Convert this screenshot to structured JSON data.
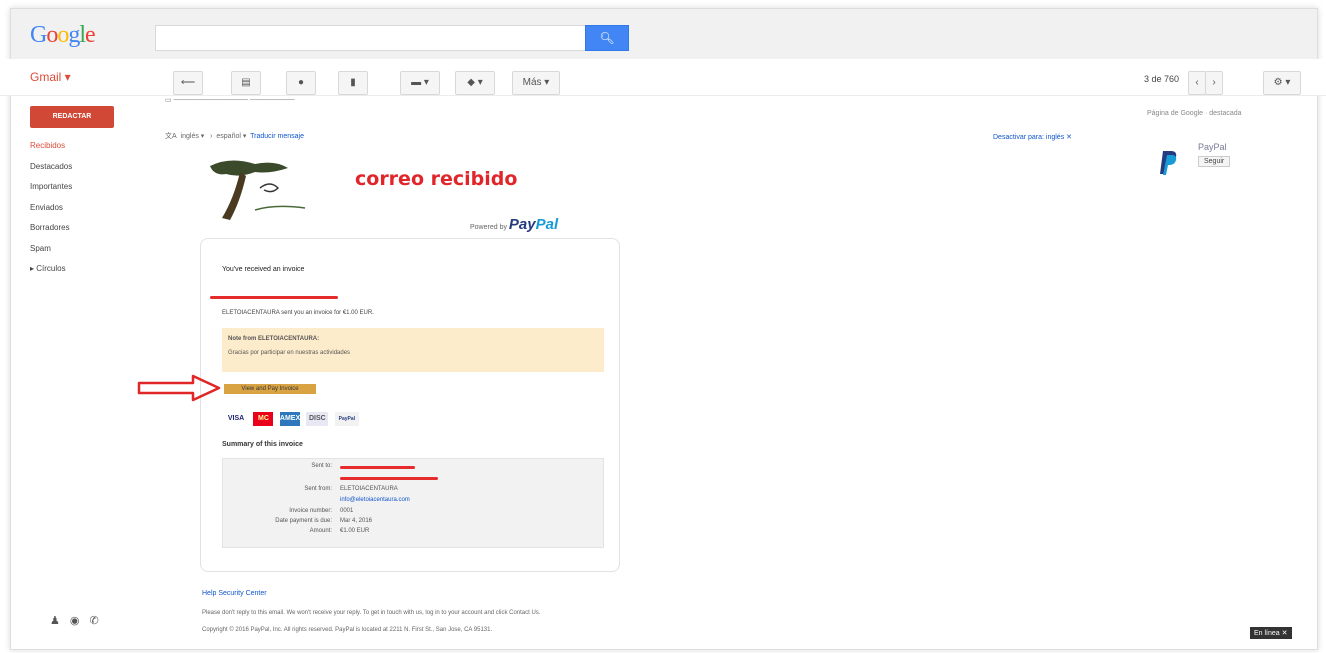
{
  "header": {
    "logo_letters": [
      "G",
      "o",
      "o",
      "g",
      "l",
      "e"
    ],
    "logo_colors": [
      "#4285f4",
      "#ea4335",
      "#fbbc05",
      "#4285f4",
      "#34a853",
      "#ea4335"
    ],
    "search_value": "",
    "search_icon": "search-icon"
  },
  "toolbar": {
    "app_label": "Gmail ▾",
    "more_label": "Más ▾",
    "count_label": "3 de 760",
    "settings_icon": "gear-icon"
  },
  "sidebar": {
    "compose_label": "REDACTAR",
    "items": [
      {
        "label": "Recibidos",
        "active": true
      },
      {
        "label": "Destacados",
        "active": false
      },
      {
        "label": "Importantes",
        "active": false
      },
      {
        "label": "Enviados",
        "active": false
      },
      {
        "label": "Borradores",
        "active": false
      },
      {
        "label": "Spam",
        "active": false
      },
      {
        "label": "▸ Círculos",
        "active": false
      }
    ]
  },
  "message": {
    "translate_from": "inglés ▾",
    "translate_arrow": "›",
    "translate_to": "español ▾",
    "translate_link": "Traducir mensaje",
    "turn_off": "Desactivar para: inglés ✕"
  },
  "right_panel": {
    "heading": "Página de Google · destacada",
    "name": "PayPal",
    "follow_label": "Seguir"
  },
  "email": {
    "annotation": "correo recibido",
    "powered_by": "Powered by",
    "brand_pay": "Pay",
    "brand_pal": "Pal",
    "invoice_title": "You've received an invoice",
    "sent_line": "ELETOIACENTAURA sent you an invoice for €1.00 EUR.",
    "note_from": "Note from ELETOIACENTAURA:",
    "note_text": "Gracias por participar en nuestras actividades",
    "pay_button": "View and Pay Invoice",
    "card_logos": [
      "VISA",
      "MC",
      "AMEX",
      "DISC",
      "PayPal"
    ],
    "summary_title": "Summary of this invoice",
    "summary_rows": [
      {
        "key": "Sent to:",
        "value": ""
      },
      {
        "key": "Sent from:",
        "value": "ELETOIACENTAURA"
      },
      {
        "key": "",
        "value": "info@eletoiacentaura.com"
      },
      {
        "key": "Invoice number:",
        "value": "0001"
      },
      {
        "key": "Date payment is due:",
        "value": "Mar 4, 2016"
      },
      {
        "key": "Amount:",
        "value": "€1.00 EUR"
      }
    ],
    "footer_help": "Help   Security Center",
    "footer_note": "Please don't reply to this email. We won't receive your reply. To get in touch with us, log in to your account and click Contact Us.",
    "footer_copy": "Copyright © 2016 PayPal, Inc. All rights reserved. PayPal is located at 2211 N. First St., San Jose, CA 95131."
  },
  "corner_badge": "En línea ✕"
}
